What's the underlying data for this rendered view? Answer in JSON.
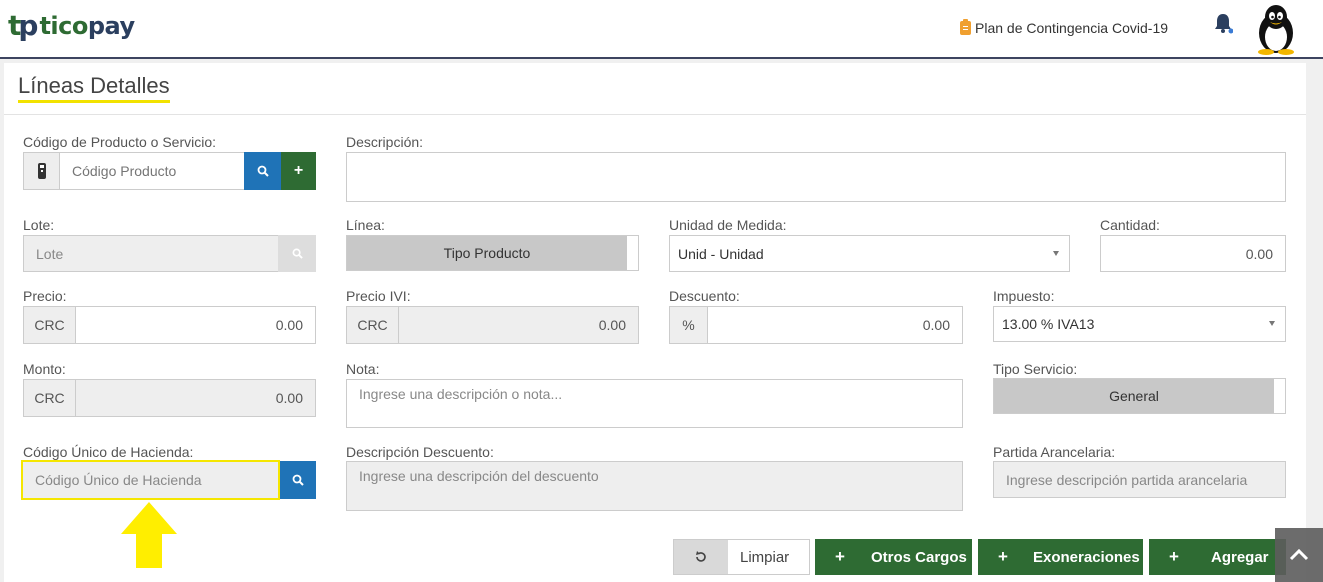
{
  "header": {
    "logo_mark": "tp",
    "logo_text_1": "tico",
    "logo_text_2": "pay",
    "covid_link": "Plan de Contingencia Covid-19",
    "icons": [
      "clipboard-icon",
      "bell-icon",
      "penguin-avatar"
    ]
  },
  "card": {
    "title": "Líneas Detalles"
  },
  "form": {
    "codigo_producto": {
      "label": "Código de Producto o Servicio:",
      "placeholder": "Código Producto"
    },
    "descripcion": {
      "label": "Descripción:",
      "value": ""
    },
    "lote": {
      "label": "Lote:",
      "placeholder": "Lote"
    },
    "linea": {
      "label": "Línea:",
      "value": "Tipo Producto"
    },
    "unidad": {
      "label": "Unidad de Medida:",
      "value": "Unid - Unidad"
    },
    "cantidad": {
      "label": "Cantidad:",
      "value": "0.00"
    },
    "precio": {
      "label": "Precio:",
      "currency": "CRC",
      "value": "0.00"
    },
    "precio_ivi": {
      "label": "Precio IVI:",
      "currency": "CRC",
      "value": "0.00"
    },
    "descuento": {
      "label": "Descuento:",
      "unit": "%",
      "value": "0.00"
    },
    "impuesto": {
      "label": "Impuesto:",
      "value": "13.00 % IVA13"
    },
    "monto": {
      "label": "Monto:",
      "currency": "CRC",
      "value": "0.00"
    },
    "nota": {
      "label": "Nota:",
      "placeholder": "Ingrese una descripción o nota..."
    },
    "tipo_servicio": {
      "label": "Tipo Servicio:",
      "value": "General"
    },
    "codigo_hacienda": {
      "label": "Código Único de Hacienda:",
      "placeholder": "Código Único de Hacienda"
    },
    "descripcion_descuento": {
      "label": "Descripción Descuento:",
      "placeholder": "Ingrese una descripción del descuento"
    },
    "partida": {
      "label": "Partida Arancelaria:",
      "placeholder": "Ingrese descripción partida arancelaria"
    }
  },
  "actions": {
    "limpiar": "Limpiar",
    "otros_cargos": "Otros Cargos",
    "exoneraciones": "Exoneraciones",
    "agregar": "Agregar"
  },
  "colors": {
    "green": "#2e6b33",
    "blue": "#1f73b7",
    "highlight": "#f5e600"
  }
}
